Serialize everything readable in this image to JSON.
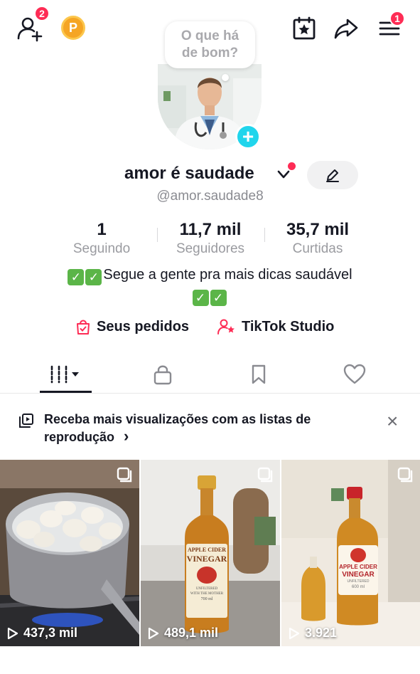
{
  "topbar": {
    "friends_badge": "2",
    "coin_letter": "P",
    "menu_badge": "1"
  },
  "avatar": {
    "bubble_line1": "O que há",
    "bubble_line2": "de bom?",
    "add_symbol": "+"
  },
  "profile": {
    "name": "amor é saudade",
    "handle": "@amor.saudade8"
  },
  "stats": [
    {
      "value": "1",
      "label": "Seguindo"
    },
    {
      "value": "11,7 mil",
      "label": "Seguidores"
    },
    {
      "value": "35,7 mil",
      "label": "Curtidas"
    }
  ],
  "bio": {
    "text": "Segue a gente pra mais dicas saudável",
    "check": "✓"
  },
  "links": {
    "orders": "Seus pedidos",
    "studio": "TikTok Studio"
  },
  "banner": {
    "text": "Receba mais visualizações com as listas de reprodução",
    "arrow": "›",
    "close": "×"
  },
  "videos": [
    {
      "views": "437,3 mil"
    },
    {
      "views": "489,1 mil",
      "label_line1": "APPLE CIDER",
      "label_line2": "VINEGAR",
      "label_line3": "UNFILTERED",
      "label_line4": "WITH THE MOTHER",
      "label_line5": "700 ml"
    },
    {
      "views": "3.921",
      "label_line1": "APPLE CIDER",
      "label_line2": "VINEGAR",
      "label_line3": "UNFILTERED",
      "label_line4": "600 ml"
    }
  ],
  "colors": {
    "accent": "#fe2c55",
    "teal": "#20d5ec",
    "coin": "#f5a524"
  },
  "icons": {
    "add_friends": "person-plus-icon",
    "coin": "coin-icon",
    "calendar": "calendar-star-icon",
    "share": "share-arrow-icon",
    "menu": "hamburger-menu-icon",
    "edit": "pencil-icon",
    "orders": "shopping-bag-icon",
    "studio": "person-star-icon",
    "videos_tab": "grid-bars-icon",
    "private_tab": "lock-icon",
    "saved_tab": "bookmark-icon",
    "liked_tab": "heart-icon",
    "playlist": "playlist-icon",
    "play": "play-icon",
    "multi": "multi-clip-icon"
  }
}
